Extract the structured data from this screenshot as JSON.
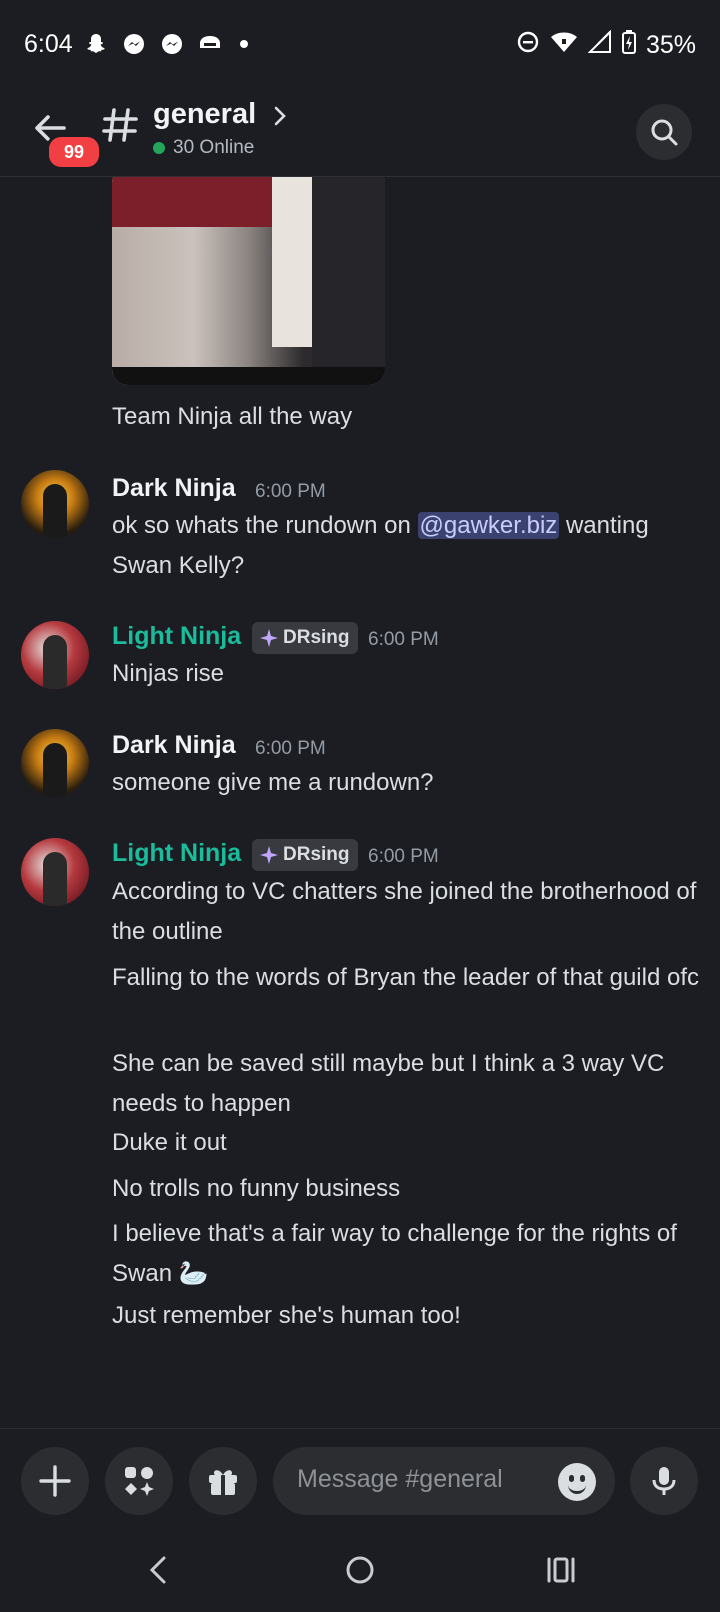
{
  "status_bar": {
    "time": "6:04",
    "left_icons": [
      "snapchat-icon",
      "messenger-icon",
      "messenger-icon",
      "headset-icon"
    ],
    "right_icons": [
      "do-not-disturb-icon",
      "wifi-icon",
      "signal-icon",
      "battery-charging-icon"
    ],
    "battery": "35%"
  },
  "header": {
    "badge": "99",
    "channel_name": "general",
    "online_text": "30 Online",
    "online_color": "#23a55a"
  },
  "messages": {
    "attachment_caption": "Team Ninja all the way",
    "m1": {
      "author": "Dark Ninja",
      "time": "6:00 PM",
      "text_before": "ok so whats the rundown on ",
      "mention": "@gawker.biz",
      "text_after": " wanting Swan Kelly?"
    },
    "m2": {
      "author": "Light Ninja",
      "tag": "DRsing",
      "time": "6:00 PM",
      "text": "Ninjas rise"
    },
    "m3": {
      "author": "Dark Ninja",
      "time": "6:00 PM",
      "text": "someone give me a rundown?"
    },
    "m4": {
      "author": "Light Ninja",
      "tag": "DRsing",
      "time": "6:00 PM",
      "lines": [
        "According to VC chatters she joined the brotherhood of the outline",
        "Falling to the words of Bryan the leader of that guild ofc",
        "She can be saved still maybe but I think a 3 way VC needs to happen",
        "Duke it out",
        "No trolls no funny business",
        "I believe that's a fair way to challenge for the rights of Swan",
        "Just remember she's human too!"
      ],
      "swan_emoji": "🦢"
    },
    "light_name_color": "#1abc9c"
  },
  "composer": {
    "placeholder": "Message #general"
  }
}
